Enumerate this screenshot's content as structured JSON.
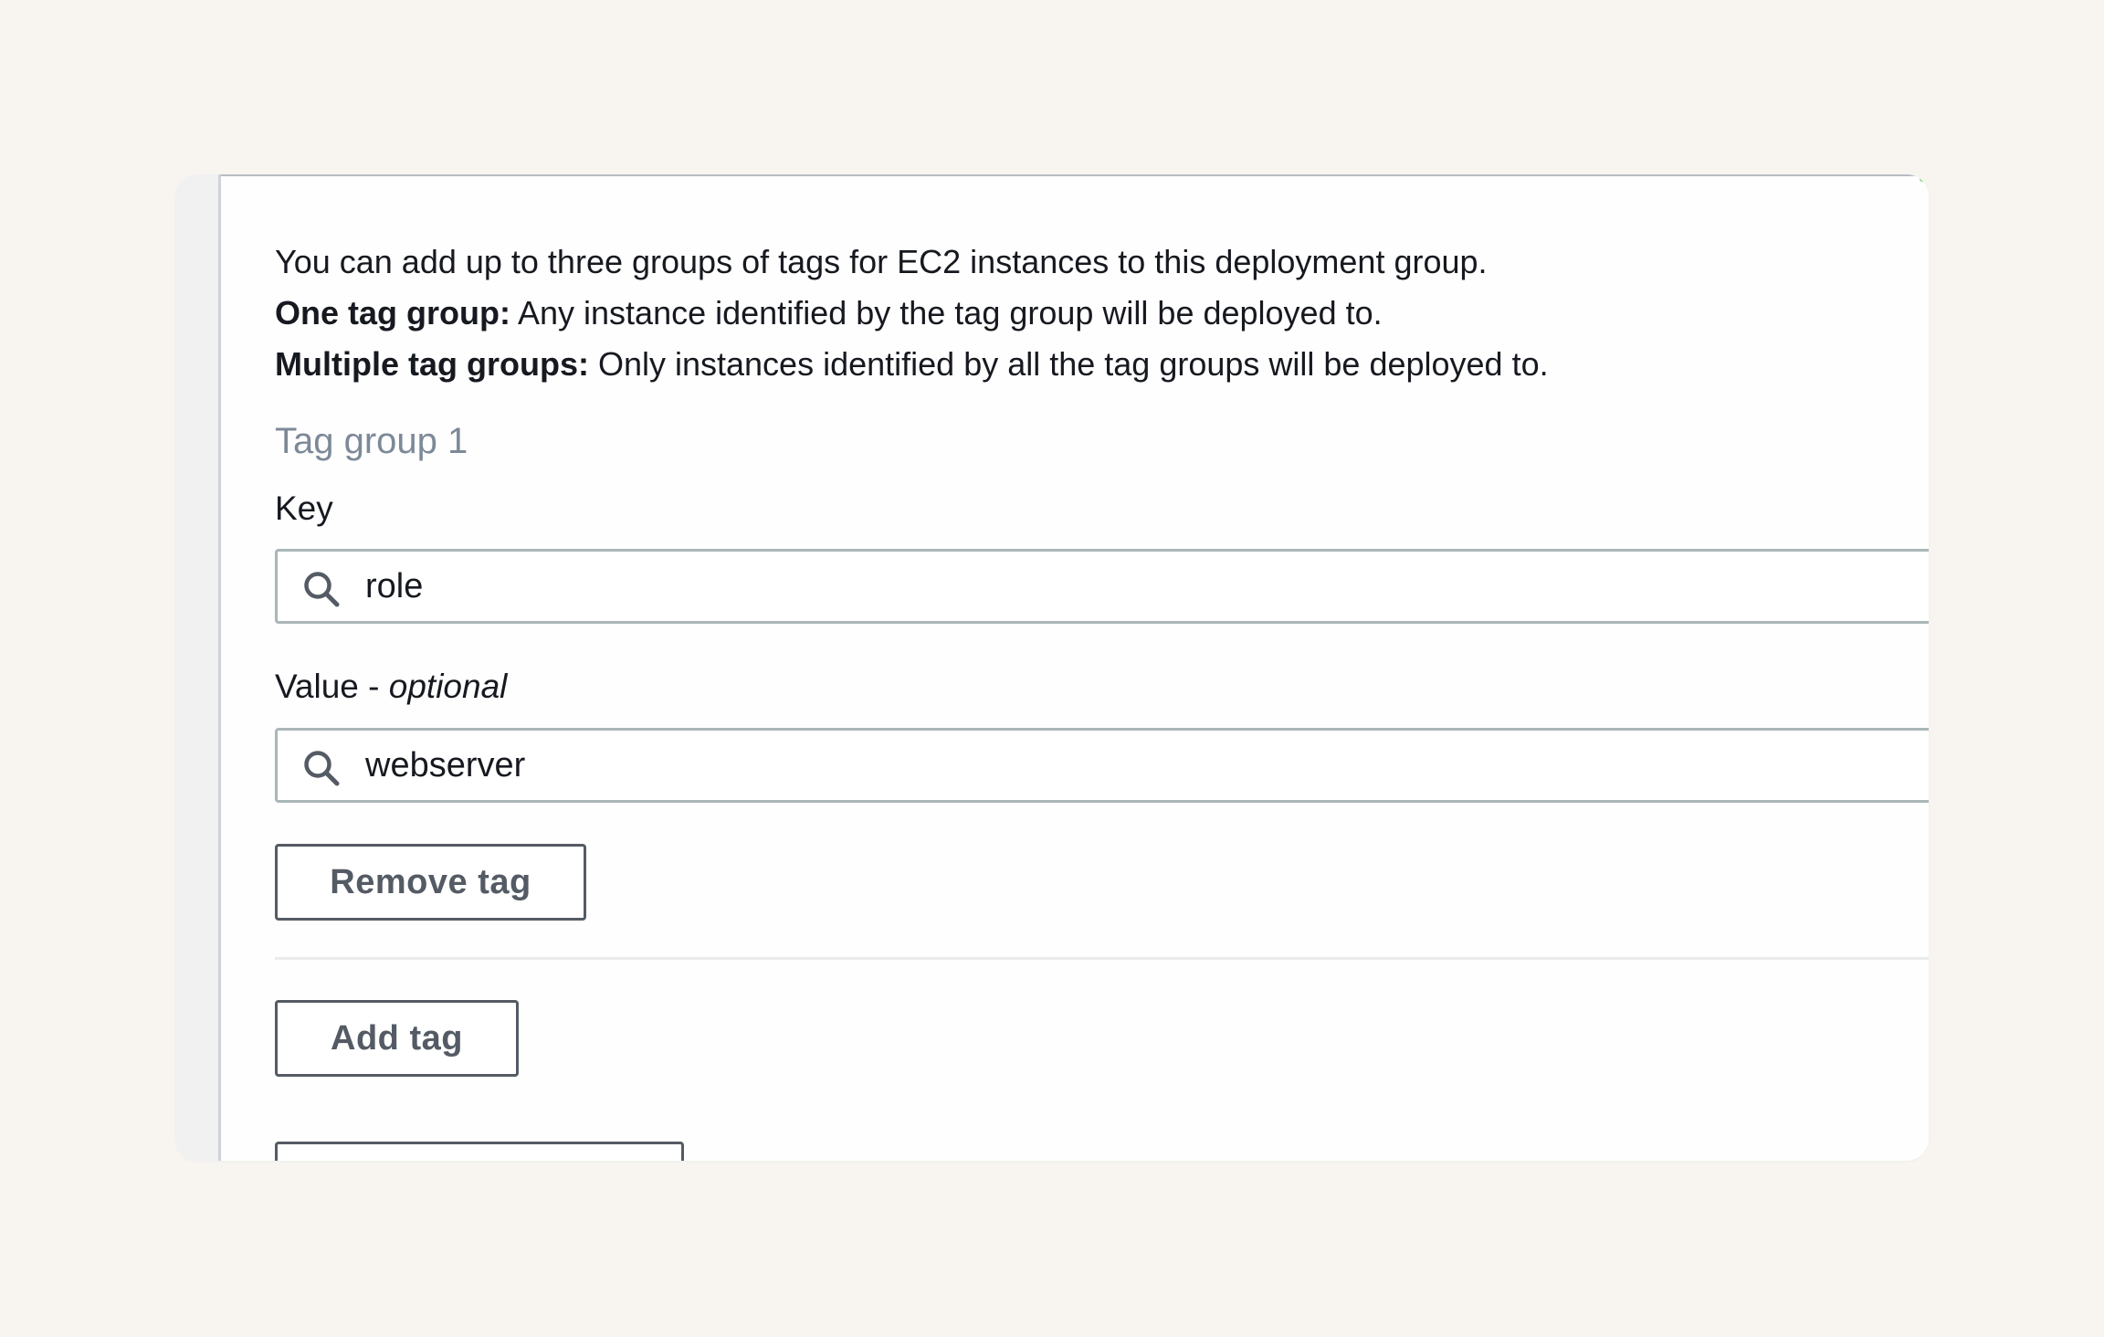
{
  "intro": {
    "line1": "You can add up to three groups of tags for EC2 instances to this deployment group.",
    "line2_bold": "One tag group:",
    "line2_rest": " Any instance identified by the tag group will be deployed to.",
    "line3_bold": "Multiple tag groups:",
    "line3_rest": " Only instances identified by all the tag groups will be deployed to."
  },
  "tag_group": {
    "title": "Tag group 1",
    "key": {
      "label": "Key",
      "value": "role",
      "icon": "search-icon"
    },
    "value": {
      "label": "Value - ",
      "label_hint": "optional",
      "value": "webserver",
      "icon": "search-icon"
    },
    "remove_label": "Remove tag"
  },
  "add_tag_label": "Add tag",
  "colors": {
    "page_background": "#f8f5f1",
    "card_background": "#fefefe",
    "input_border": "#aab7b8",
    "button_border": "#545b64",
    "muted_heading": "#7d8998"
  }
}
